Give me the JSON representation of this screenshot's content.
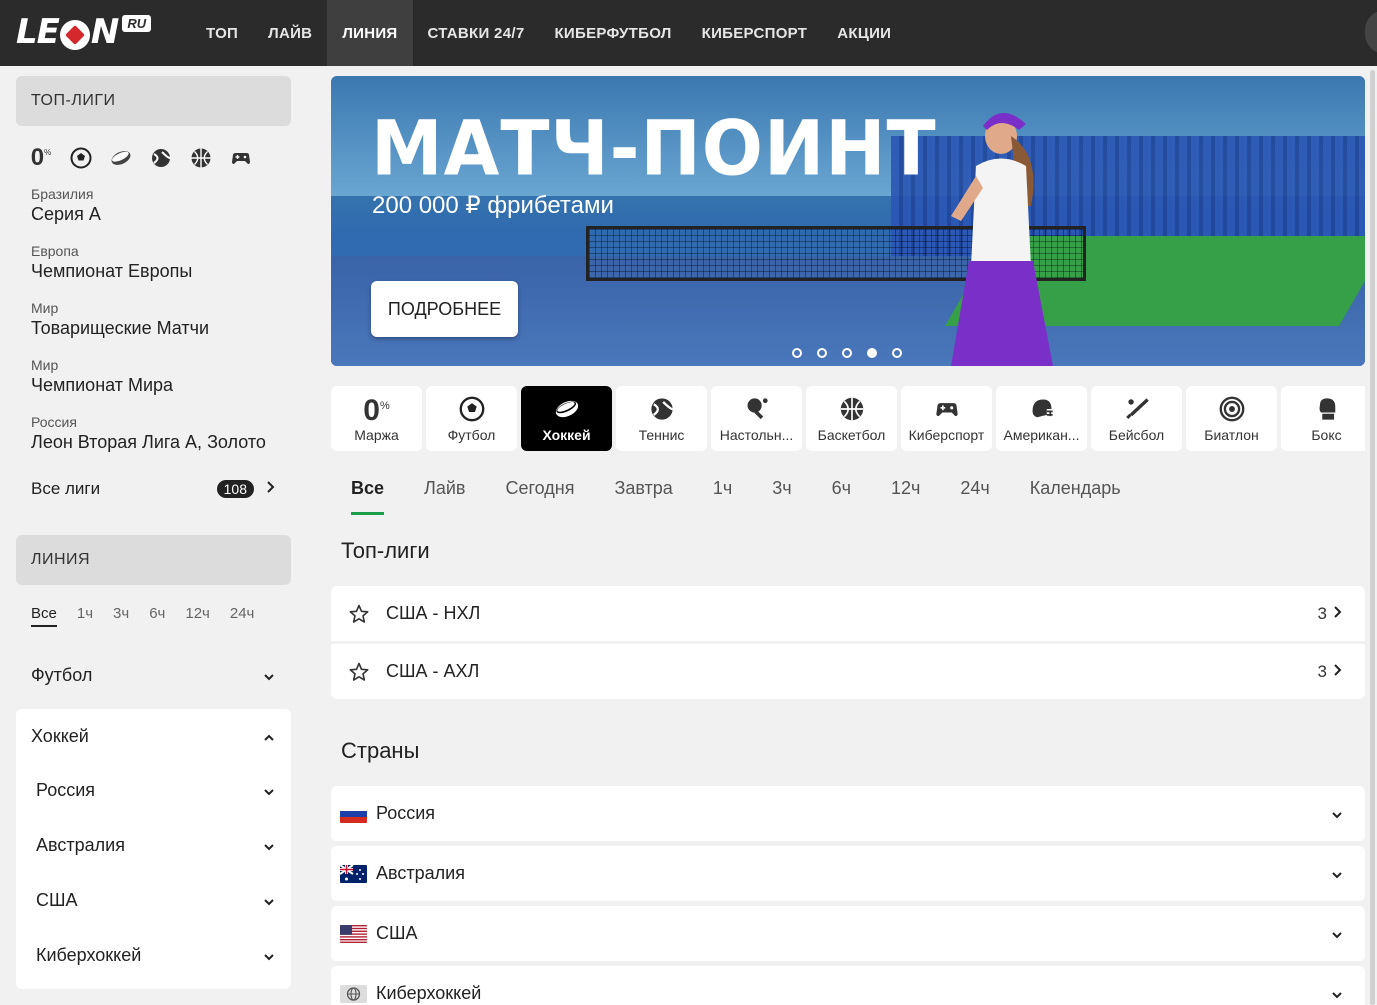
{
  "header": {
    "logo_text_left": "LE",
    "logo_text_right": "N",
    "logo_badge": "RU",
    "nav": [
      "ТОП",
      "ЛАЙВ",
      "ЛИНИЯ",
      "СТАВКИ 24/7",
      "КИБЕРФУТБОЛ",
      "КИБЕРСПОРТ",
      "АКЦИИ"
    ],
    "active_nav": "ЛИНИЯ"
  },
  "sidebar": {
    "top_leagues_title": "ТОП-ЛИГИ",
    "marja_icon_text": "0",
    "marja_icon_sup": "%",
    "sport_icons": [
      "football-icon",
      "hockey-puck-icon",
      "tennis-icon",
      "basketball-icon",
      "gamepad-icon"
    ],
    "leagues": [
      {
        "category": "Бразилия",
        "name": "Серия А"
      },
      {
        "category": "Европа",
        "name": "Чемпионат Европы"
      },
      {
        "category": "Мир",
        "name": "Товарищеские Матчи"
      },
      {
        "category": "Мир",
        "name": "Чемпионат Мира"
      },
      {
        "category": "Россия",
        "name": "Леон Вторая Лига А, Золото"
      }
    ],
    "all_leagues_label": "Все лиги",
    "all_leagues_count": "108",
    "line_title": "ЛИНИЯ",
    "time_tabs": [
      "Все",
      "1ч",
      "3ч",
      "6ч",
      "12ч",
      "24ч"
    ],
    "football_label": "Футбол",
    "hockey_label": "Хоккей",
    "hockey_sub": [
      "Россия",
      "Австралия",
      "США",
      "Киберхоккей"
    ]
  },
  "banner": {
    "title": "МАТЧ-ПОИНТ",
    "subtitle": "200 000 ₽ фрибетами",
    "button": "ПОДРОБНЕЕ",
    "slides_total": 5,
    "active_slide": 4
  },
  "sports_bar": [
    {
      "label": "Маржа",
      "icon": "percent-icon",
      "big": "0",
      "sup": "%"
    },
    {
      "label": "Футбол",
      "icon": "football-icon"
    },
    {
      "label": "Хоккей",
      "icon": "hockey-puck-icon",
      "active": true
    },
    {
      "label": "Теннис",
      "icon": "tennis-icon"
    },
    {
      "label": "Настольн...",
      "icon": "table-tennis-icon"
    },
    {
      "label": "Баскетбол",
      "icon": "basketball-icon"
    },
    {
      "label": "Киберспорт",
      "icon": "gamepad-icon"
    },
    {
      "label": "Американ...",
      "icon": "helmet-icon"
    },
    {
      "label": "Бейсбол",
      "icon": "baseball-bat-icon"
    },
    {
      "label": "Биатлон",
      "icon": "target-icon"
    },
    {
      "label": "Бокс",
      "icon": "boxing-glove-icon"
    }
  ],
  "filter_tabs": [
    "Все",
    "Лайв",
    "Сегодня",
    "Завтра",
    "1ч",
    "3ч",
    "6ч",
    "12ч",
    "24ч",
    "Календарь"
  ],
  "top_leagues_section": {
    "title": "Топ-лиги",
    "items": [
      {
        "name": "США - НХЛ",
        "count": "3"
      },
      {
        "name": "США - АХЛ",
        "count": "3"
      }
    ]
  },
  "countries_section": {
    "title": "Страны",
    "items": [
      {
        "name": "Россия",
        "flag": "russia-flag"
      },
      {
        "name": "Австралия",
        "flag": "australia-flag"
      },
      {
        "name": "США",
        "flag": "usa-flag"
      },
      {
        "name": "Киберхоккей",
        "flag": "globe-icon"
      }
    ]
  },
  "colors": {
    "header_bg": "#2b2b2b",
    "accent_green": "#1a9e4a",
    "active_sport_bg": "#000000"
  }
}
